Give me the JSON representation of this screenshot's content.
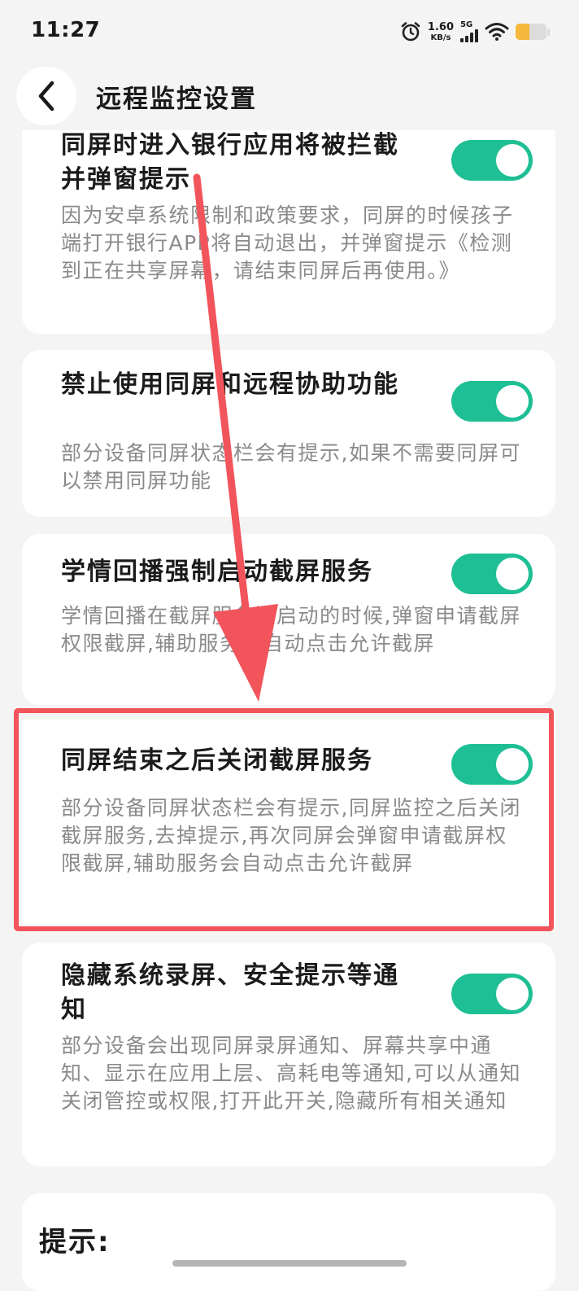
{
  "status_bar": {
    "time": "11:27",
    "net_speed_value": "1.60",
    "net_speed_unit": "KB/s",
    "network_type": "5G",
    "battery_percent": 45
  },
  "header": {
    "title": "远程监控设置"
  },
  "settings": [
    {
      "title": "同屏时进入银行应用将被拦截并弹窗提示",
      "description": "因为安卓系统限制和政策要求，同屏的时候孩子端打开银行APP将自动退出，并弹窗提示《检测到正在共享屏幕，请结束同屏后再使用。》",
      "enabled": true
    },
    {
      "title": "禁止使用同屏和远程协助功能",
      "description": "部分设备同屏状态栏会有提示,如果不需要同屏可以禁用同屏功能",
      "enabled": true
    },
    {
      "title": "学情回播强制启动截屏服务",
      "description": "学情回播在截屏服务没启动的时候,弹窗申请截屏权限截屏,辅助服务会自动点击允许截屏",
      "enabled": true
    },
    {
      "title": "同屏结束之后关闭截屏服务",
      "description": "部分设备同屏状态栏会有提示,同屏监控之后关闭截屏服务,去掉提示,再次同屏会弹窗申请截屏权限截屏,辅助服务会自动点击允许截屏",
      "enabled": true
    },
    {
      "title": "隐藏系统录屏、安全提示等通知",
      "description": "部分设备会出现同屏录屏通知、屏幕共享中通知、显示在应用上层、高耗电等通知,可以从通知关闭管控或权限,打开此开关,隐藏所有相关通知",
      "enabled": true
    }
  ],
  "tips": {
    "title": "提示:"
  },
  "colors": {
    "toggle_on": "#1fbf95",
    "annotation_red": "#f2545b",
    "battery": "#f6b73c"
  }
}
